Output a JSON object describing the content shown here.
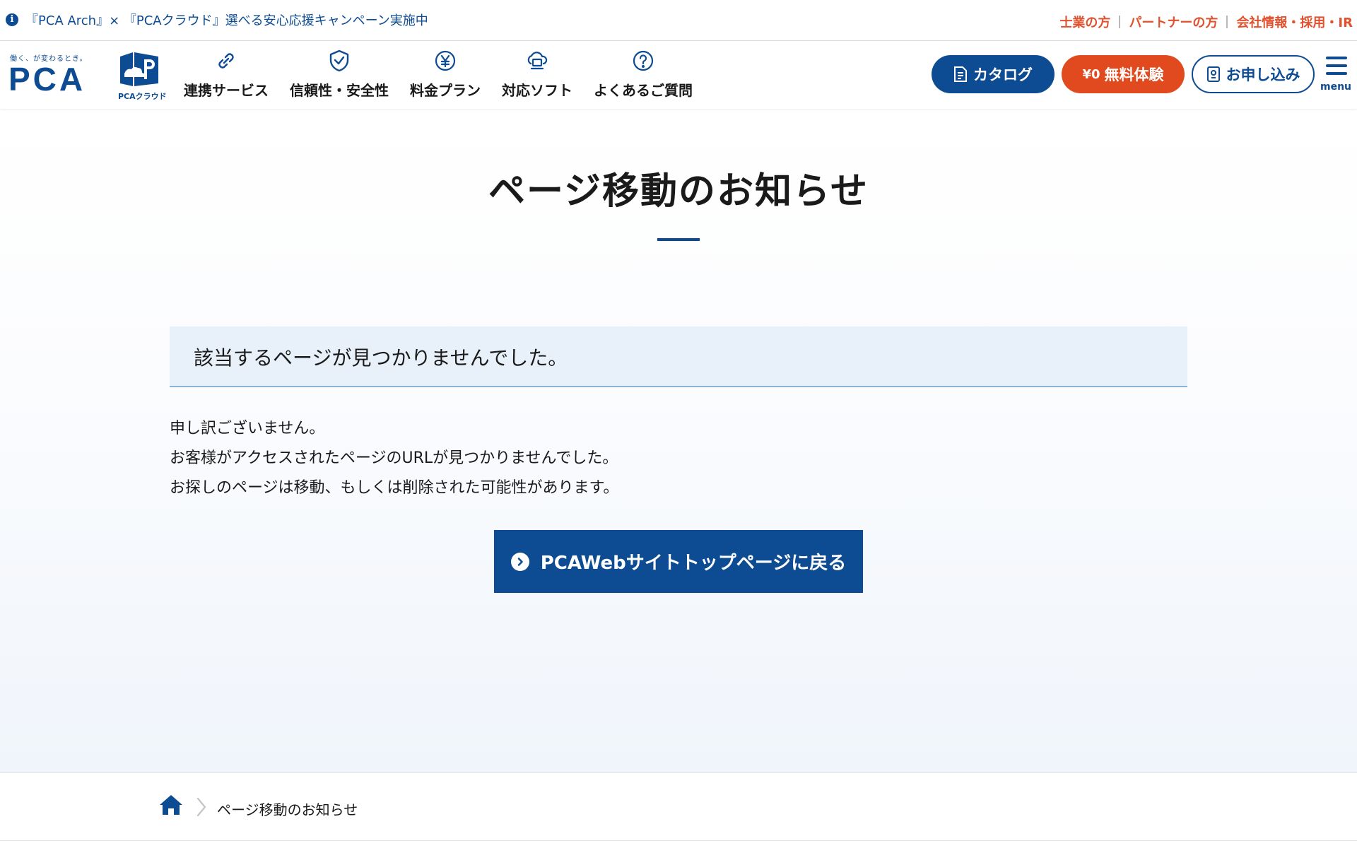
{
  "topbar": {
    "notice": "『PCA Arch』× 『PCAクラウド』選べる安心応援キャンペーン実施中",
    "links": [
      "士業の方",
      "パートナーの方",
      "会社情報・採用・IR"
    ]
  },
  "header": {
    "logo_tagline": "働く、が変わるとき。",
    "logo_text": "PCA",
    "cloud_caption": "PCAクラウド",
    "nav": [
      {
        "label": "連携サービス",
        "icon": "link-icon"
      },
      {
        "label": "信頼性・安全性",
        "icon": "shield-check-icon"
      },
      {
        "label": "料金プラン",
        "icon": "yen-icon"
      },
      {
        "label": "対応ソフト",
        "icon": "cloud-monitor-icon"
      },
      {
        "label": "よくあるご質問",
        "icon": "question-icon"
      }
    ],
    "buttons": {
      "catalog": "カタログ",
      "trial_yen": "¥0",
      "trial": "無料体験",
      "apply": "お申し込み"
    },
    "menu_label": "menu"
  },
  "main": {
    "title": "ページ移動のお知らせ",
    "alert": "該当するページが見つかりませんでした。",
    "message": [
      "申し訳ございません。",
      "お客様がアクセスされたページのURLが見つかりませんでした。",
      "お探しのページは移動、もしくは削除された可能性があります。"
    ],
    "back_button": "PCAWebサイトトップページに戻る"
  },
  "breadcrumb": {
    "current": "ページ移動のお知らせ"
  },
  "colors": {
    "brand_blue": "#0d4c92",
    "accent_orange": "#e04a1e",
    "util_link_orange": "#e0522e",
    "alert_bg": "#e8f1fa"
  }
}
